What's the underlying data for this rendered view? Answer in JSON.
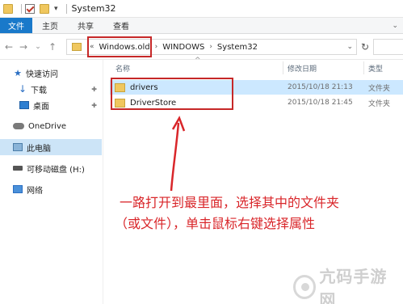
{
  "window": {
    "title": "System32"
  },
  "ribbon": {
    "tabs": [
      "文件",
      "主页",
      "共享",
      "查看"
    ]
  },
  "address": {
    "crumbs": [
      "Windows.old",
      "WINDOWS",
      "System32"
    ]
  },
  "nav_pane": {
    "items": [
      {
        "label": "快速访问",
        "icon": "star-icon"
      },
      {
        "label": "下载",
        "icon": "download-icon",
        "pinned": true
      },
      {
        "label": "桌面",
        "icon": "desktop-icon",
        "pinned": true
      },
      {
        "label": "OneDrive",
        "icon": "cloud-icon"
      },
      {
        "label": "此电脑",
        "icon": "pc-icon",
        "selected": true
      },
      {
        "label": "可移动磁盘 (H:)",
        "icon": "usb-drive-icon"
      },
      {
        "label": "网络",
        "icon": "network-icon"
      }
    ]
  },
  "columns": {
    "name": "名称",
    "date": "修改日期",
    "type": "类型"
  },
  "files": [
    {
      "name": "drivers",
      "date": "2015/10/18 21:13",
      "type": "文件夹",
      "selected": true
    },
    {
      "name": "DriverStore",
      "date": "2015/10/18 21:45",
      "type": "文件夹",
      "selected": false
    }
  ],
  "annotation": {
    "line1": "一路打开到最里面，选择其中的文件夹",
    "line2": "（或文件），单击鼠标右键选择属性"
  },
  "watermark": {
    "text": "亢码手游网"
  },
  "colors": {
    "highlight_red": "#c62828",
    "file_tab_blue": "#1979ca",
    "selection": "#cce8ff"
  }
}
